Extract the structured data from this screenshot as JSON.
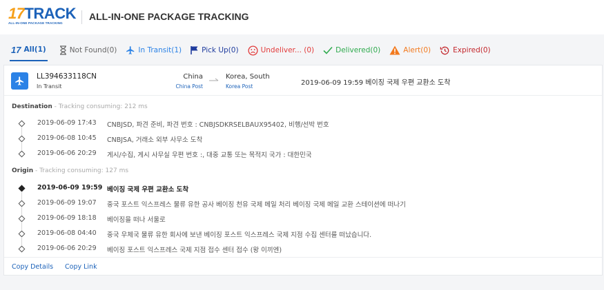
{
  "header": {
    "logo_number": "17",
    "logo_word": "TRACK",
    "logo_sub": "ALL-IN-ONE PACKAGE TRACKING",
    "title": "ALL-IN-ONE PACKAGE TRACKING",
    "brand_color": "#1c62b9",
    "accent_color": "#f6a01a"
  },
  "tabs": [
    {
      "label": "All(1)",
      "icon": "17-logo-icon",
      "color": "#1c62b9"
    },
    {
      "label": "Not Found(0)",
      "icon": "hourglass-icon",
      "color": "#666666"
    },
    {
      "label": "In Transit(1)",
      "icon": "plane-icon",
      "color": "#2b82e6"
    },
    {
      "label": "Pick Up(0)",
      "icon": "flag-icon",
      "color": "#1f3c9e"
    },
    {
      "label": "Undeliver... (0)",
      "icon": "sad-face-icon",
      "color": "#e23b3b"
    },
    {
      "label": "Delivered(0)",
      "icon": "check-icon",
      "color": "#2faa4e"
    },
    {
      "label": "Alert(0)",
      "icon": "warning-icon",
      "color": "#f27a1f"
    },
    {
      "label": "Expired(0)",
      "icon": "history-icon",
      "color": "#c3262b"
    }
  ],
  "shipment": {
    "tracking_number": "LL394633118CN",
    "status": "In Transit",
    "origin_country": "China",
    "origin_carrier": "China Post",
    "destination_country": "Korea, South",
    "destination_carrier": "Korea Post",
    "latest_event": "2019-06-09 19:59  베이징 국제 우편 교환소 도착"
  },
  "destination": {
    "label": "Destination",
    "consuming": " - Tracking consuming: 212 ms",
    "events": [
      {
        "time": "2019-06-09 17:43",
        "desc": "CNBJSD, 파견 준비, 파견 번호 : CNBJSDKRSELBAUX95402, 비행/선박 번호"
      },
      {
        "time": "2019-06-08 10:45",
        "desc": "CNBJSA, 거래소 외부 사무소 도착"
      },
      {
        "time": "2019-06-06 20:29",
        "desc": "게시/수집, 게시 사무실 우편 번호 :, 대중 교통 또는 목적지 국가 : 대한민국"
      }
    ]
  },
  "origin": {
    "label": "Origin",
    "consuming": " - Tracking consuming: 127 ms",
    "events": [
      {
        "time": "2019-06-09 19:59",
        "desc": "베이징 국제 우편 교환소 도착"
      },
      {
        "time": "2019-06-09 19:07",
        "desc": "중국 포스트 익스프레스 물류 유한 공사 베이징 천유 국제 메일 처리 베이징 국제 메일 교환 스테이션에 떠나기"
      },
      {
        "time": "2019-06-09 18:18",
        "desc": "베이징을 떠나 서울로"
      },
      {
        "time": "2019-06-08 04:40",
        "desc": "중국 우체국 물류 유한 회사에 보낸 베이징 포스트 익스프레스 국제 지점 수집 센터를 떠났습니다."
      },
      {
        "time": "2019-06-06 20:29",
        "desc": "베이징 포스트 익스프레스 국제 지점 접수 센터 접수 (왕 이끼엔)"
      }
    ]
  },
  "actions": {
    "copy_details": "Copy Details",
    "copy_link": "Copy Link"
  }
}
